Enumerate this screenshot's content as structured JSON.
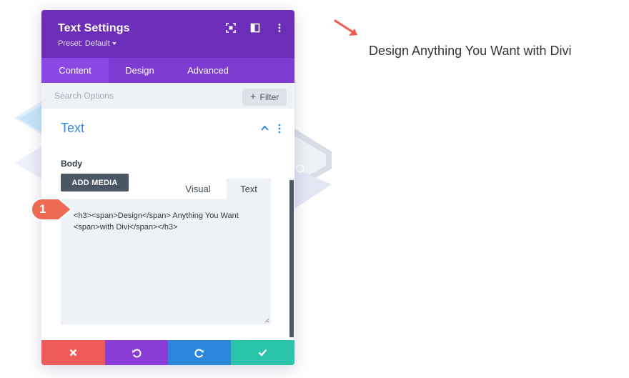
{
  "modal": {
    "title": "Text Settings",
    "preset": "Preset: Default",
    "header_icons": [
      "expand-icon",
      "columns-icon",
      "more-vertical-icon"
    ],
    "tabs": [
      {
        "label": "Content",
        "active": true
      },
      {
        "label": "Design",
        "active": false
      },
      {
        "label": "Advanced",
        "active": false
      }
    ],
    "search": {
      "placeholder": "Search Options"
    },
    "filter": {
      "label": "Filter",
      "icon": "plus-icon"
    },
    "section": {
      "title": "Text",
      "expanded": true
    },
    "body_label": "Body",
    "add_media_label": "ADD MEDIA",
    "editor_tabs": {
      "visual": "Visual",
      "text": "Text",
      "selected": "text"
    },
    "editor_content_line1": "<h3><span>Design</span> Anything You Want",
    "editor_content_line2": "<span>with Divi</span></h3>",
    "footer": [
      "close-icon",
      "undo-icon",
      "redo-icon",
      "check-icon"
    ]
  },
  "callout": {
    "number": "1"
  },
  "preview": {
    "heading": "Design Anything You Want with Divi"
  },
  "colors": {
    "header": "#6c2eb9",
    "tabs": "#7d3bd1",
    "active_tab": "#8b47e3",
    "section_title": "#2e8ae6",
    "cancel": "#ef5b5b",
    "undo": "#8a3cd6",
    "redo": "#2b87da",
    "save": "#29c4a9",
    "callout": "#ef6a52"
  }
}
